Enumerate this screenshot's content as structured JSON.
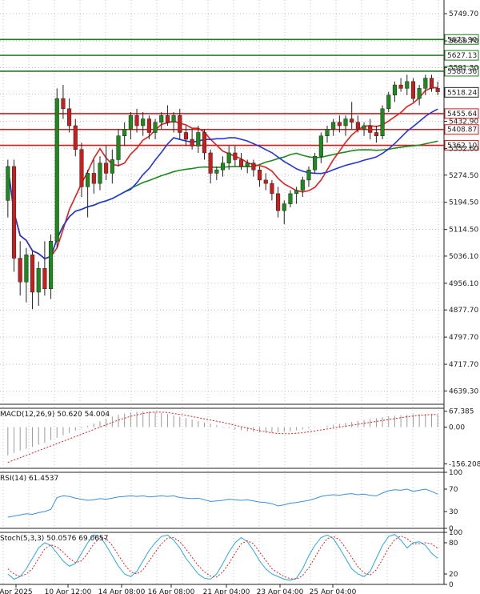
{
  "chart_data": [
    {
      "type": "candlestick",
      "panel": "price",
      "ylim": [
        4600,
        5790
      ],
      "y_ticks": [
        "5749.70",
        "5669.70",
        "5591.30",
        "5513.00",
        "5432.90",
        "5352.60",
        "5274.50",
        "5194.50",
        "5114.50",
        "5036.10",
        "4956.10",
        "4877.70",
        "4797.70",
        "4717.70",
        "4639.30"
      ],
      "last_price": "5518.24",
      "levels": [
        {
          "label": "5673.90",
          "value": 5673.9,
          "color": "#1e7d1e"
        },
        {
          "label": "5627.13",
          "value": 5627.13,
          "color": "#1e7d1e"
        },
        {
          "label": "5580.36",
          "value": 5580.36,
          "color": "#1e7d1e"
        },
        {
          "label": "5455.64",
          "value": 5455.64,
          "color": "#d51a1a"
        },
        {
          "label": "5408.87",
          "value": 5408.87,
          "color": "#d51a1a"
        },
        {
          "label": "5362.10",
          "value": 5362.1,
          "color": "#d51a1a"
        }
      ],
      "candles": [
        [
          5200,
          5320,
          5150,
          5300
        ],
        [
          5300,
          5320,
          4990,
          5030
        ],
        [
          5030,
          5080,
          4920,
          4960
        ],
        [
          4960,
          5060,
          4900,
          5040
        ],
        [
          5040,
          5050,
          4880,
          4930
        ],
        [
          4930,
          5020,
          4890,
          5000
        ],
        [
          5000,
          5080,
          4920,
          4940
        ],
        [
          4940,
          5100,
          4910,
          5080
        ],
        [
          5080,
          5530,
          5060,
          5500
        ],
        [
          5500,
          5540,
          5440,
          5470
        ],
        [
          5470,
          5500,
          5400,
          5420
        ],
        [
          5420,
          5440,
          5330,
          5350
        ],
        [
          5350,
          5370,
          5210,
          5240
        ],
        [
          5240,
          5290,
          5150,
          5280
        ],
        [
          5280,
          5320,
          5220,
          5250
        ],
        [
          5250,
          5330,
          5230,
          5310
        ],
        [
          5310,
          5360,
          5260,
          5280
        ],
        [
          5280,
          5350,
          5250,
          5320
        ],
        [
          5320,
          5410,
          5300,
          5390
        ],
        [
          5390,
          5430,
          5360,
          5410
        ],
        [
          5410,
          5460,
          5380,
          5450
        ],
        [
          5450,
          5470,
          5400,
          5420
        ],
        [
          5420,
          5460,
          5390,
          5440
        ],
        [
          5440,
          5450,
          5380,
          5400
        ],
        [
          5400,
          5440,
          5380,
          5430
        ],
        [
          5430,
          5460,
          5410,
          5450
        ],
        [
          5450,
          5480,
          5420,
          5430
        ],
        [
          5430,
          5460,
          5400,
          5450
        ],
        [
          5450,
          5470,
          5380,
          5400
        ],
        [
          5400,
          5420,
          5360,
          5380
        ],
        [
          5380,
          5410,
          5350,
          5360
        ],
        [
          5360,
          5420,
          5340,
          5400
        ],
        [
          5400,
          5410,
          5320,
          5340
        ],
        [
          5340,
          5350,
          5250,
          5280
        ],
        [
          5280,
          5300,
          5260,
          5290
        ],
        [
          5290,
          5330,
          5270,
          5310
        ],
        [
          5310,
          5360,
          5290,
          5340
        ],
        [
          5340,
          5360,
          5300,
          5320
        ],
        [
          5320,
          5340,
          5290,
          5300
        ],
        [
          5300,
          5320,
          5280,
          5310
        ],
        [
          5310,
          5320,
          5270,
          5290
        ],
        [
          5290,
          5300,
          5240,
          5260
        ],
        [
          5260,
          5280,
          5230,
          5250
        ],
        [
          5250,
          5260,
          5200,
          5220
        ],
        [
          5220,
          5240,
          5150,
          5170
        ],
        [
          5170,
          5200,
          5130,
          5190
        ],
        [
          5190,
          5230,
          5180,
          5220
        ],
        [
          5220,
          5240,
          5190,
          5230
        ],
        [
          5230,
          5270,
          5210,
          5260
        ],
        [
          5260,
          5300,
          5240,
          5290
        ],
        [
          5290,
          5340,
          5280,
          5330
        ],
        [
          5330,
          5400,
          5310,
          5390
        ],
        [
          5390,
          5420,
          5370,
          5410
        ],
        [
          5410,
          5440,
          5390,
          5430
        ],
        [
          5430,
          5450,
          5400,
          5420
        ],
        [
          5420,
          5450,
          5390,
          5440
        ],
        [
          5440,
          5490,
          5410,
          5430
        ],
        [
          5430,
          5450,
          5400,
          5410
        ],
        [
          5410,
          5430,
          5390,
          5420
        ],
        [
          5420,
          5440,
          5380,
          5400
        ],
        [
          5400,
          5420,
          5370,
          5390
        ],
        [
          5390,
          5480,
          5380,
          5470
        ],
        [
          5470,
          5520,
          5460,
          5510
        ],
        [
          5510,
          5550,
          5490,
          5540
        ],
        [
          5540,
          5560,
          5520,
          5530
        ],
        [
          5530,
          5570,
          5510,
          5550
        ],
        [
          5550,
          5560,
          5490,
          5500
        ],
        [
          5500,
          5540,
          5480,
          5530
        ],
        [
          5530,
          5570,
          5510,
          5560
        ],
        [
          5560,
          5570,
          5520,
          5530
        ],
        [
          5530,
          5550,
          5510,
          5520
        ]
      ],
      "indicators": [
        {
          "name": "ma-green",
          "color": "#1f8a1f"
        },
        {
          "name": "ma-red",
          "color": "#e02020"
        },
        {
          "name": "ma-blue",
          "color": "#2436d6"
        }
      ],
      "x_tick_labels": [
        "Apr 2025",
        "10 Apr 12:00",
        "14 Apr 08:00",
        "16 Apr 08:00",
        "21 Apr 04:00",
        "23 Apr 04:00",
        "25 Apr 04:00"
      ]
    },
    {
      "type": "bar",
      "panel": "macd",
      "title": "MACD(12,26,9) 50.620 54.004",
      "ylim": [
        -175,
        80
      ],
      "y_ticks": [
        "67.385",
        "0.00",
        "-156.208"
      ],
      "hist": [
        -120,
        -110,
        -100,
        -92,
        -84,
        -75,
        -66,
        -55,
        -45,
        -35,
        -25,
        -15,
        -5,
        5,
        15,
        25,
        35,
        45,
        52,
        58,
        62,
        65,
        67,
        66,
        64,
        60,
        56,
        50,
        44,
        38,
        32,
        26,
        20,
        14,
        8,
        2,
        -4,
        -10,
        -14,
        -18,
        -20,
        -22,
        -24,
        -24,
        -22,
        -20,
        -18,
        -14,
        -10,
        -6,
        -2,
        2,
        6,
        10,
        14,
        18,
        22,
        26,
        30,
        34,
        38,
        42,
        46,
        48,
        50,
        52,
        54,
        55,
        56,
        56,
        54
      ],
      "signal": [
        -150,
        -140,
        -130,
        -120,
        -110,
        -100,
        -90,
        -80,
        -70,
        -60,
        -50,
        -40,
        -30,
        -20,
        -10,
        0,
        10,
        20,
        30,
        38,
        46,
        52,
        58,
        62,
        64,
        64,
        62,
        58,
        54,
        50,
        45,
        40,
        35,
        30,
        25,
        20,
        14,
        8,
        2,
        -4,
        -10,
        -15,
        -20,
        -24,
        -27,
        -28,
        -28,
        -26,
        -24,
        -20,
        -16,
        -12,
        -8,
        -4,
        0,
        4,
        8,
        12,
        16,
        20,
        24,
        28,
        32,
        36,
        40,
        44,
        47,
        50,
        52,
        53,
        54
      ]
    },
    {
      "type": "line",
      "panel": "rsi",
      "title": "RSI(14) 61.4537",
      "ylim": [
        0,
        100
      ],
      "y_ticks": [
        "100",
        "70",
        "30",
        "0"
      ],
      "values": [
        20,
        22,
        24,
        26,
        25,
        28,
        30,
        34,
        55,
        58,
        57,
        54,
        52,
        50,
        51,
        53,
        52,
        54,
        56,
        57,
        58,
        57,
        58,
        56,
        57,
        58,
        57,
        58,
        55,
        54,
        53,
        54,
        51,
        48,
        49,
        50,
        52,
        51,
        50,
        51,
        49,
        47,
        46,
        44,
        40,
        42,
        45,
        46,
        48,
        50,
        53,
        57,
        59,
        60,
        59,
        61,
        62,
        60,
        61,
        59,
        58,
        63,
        67,
        69,
        68,
        70,
        66,
        68,
        70,
        66,
        61
      ]
    },
    {
      "type": "line",
      "panel": "stoch",
      "title": "Stoch(5,3,3) 50.0576 69.0657",
      "ylim": [
        0,
        100
      ],
      "y_ticks": [
        "100",
        "80",
        "20",
        "0"
      ],
      "k": [
        20,
        10,
        15,
        30,
        50,
        70,
        80,
        75,
        60,
        45,
        35,
        40,
        60,
        80,
        95,
        92,
        75,
        55,
        35,
        20,
        15,
        25,
        45,
        65,
        80,
        92,
        95,
        85,
        70,
        50,
        35,
        20,
        12,
        10,
        20,
        40,
        62,
        80,
        90,
        82,
        65,
        45,
        30,
        20,
        15,
        10,
        8,
        12,
        30,
        55,
        75,
        90,
        95,
        88,
        70,
        50,
        30,
        20,
        15,
        25,
        50,
        75,
        92,
        96,
        85,
        70,
        80,
        82,
        75,
        60,
        50
      ],
      "d": [
        30,
        20,
        15,
        20,
        30,
        50,
        68,
        76,
        72,
        62,
        50,
        42,
        45,
        60,
        78,
        90,
        88,
        75,
        56,
        38,
        24,
        20,
        28,
        45,
        62,
        78,
        89,
        90,
        82,
        68,
        52,
        36,
        24,
        16,
        14,
        24,
        40,
        60,
        78,
        84,
        78,
        62,
        46,
        30,
        22,
        15,
        11,
        10,
        17,
        32,
        52,
        72,
        88,
        92,
        86,
        70,
        52,
        34,
        22,
        18,
        28,
        48,
        70,
        86,
        93,
        88,
        78,
        78,
        80,
        78,
        69
      ]
    }
  ]
}
